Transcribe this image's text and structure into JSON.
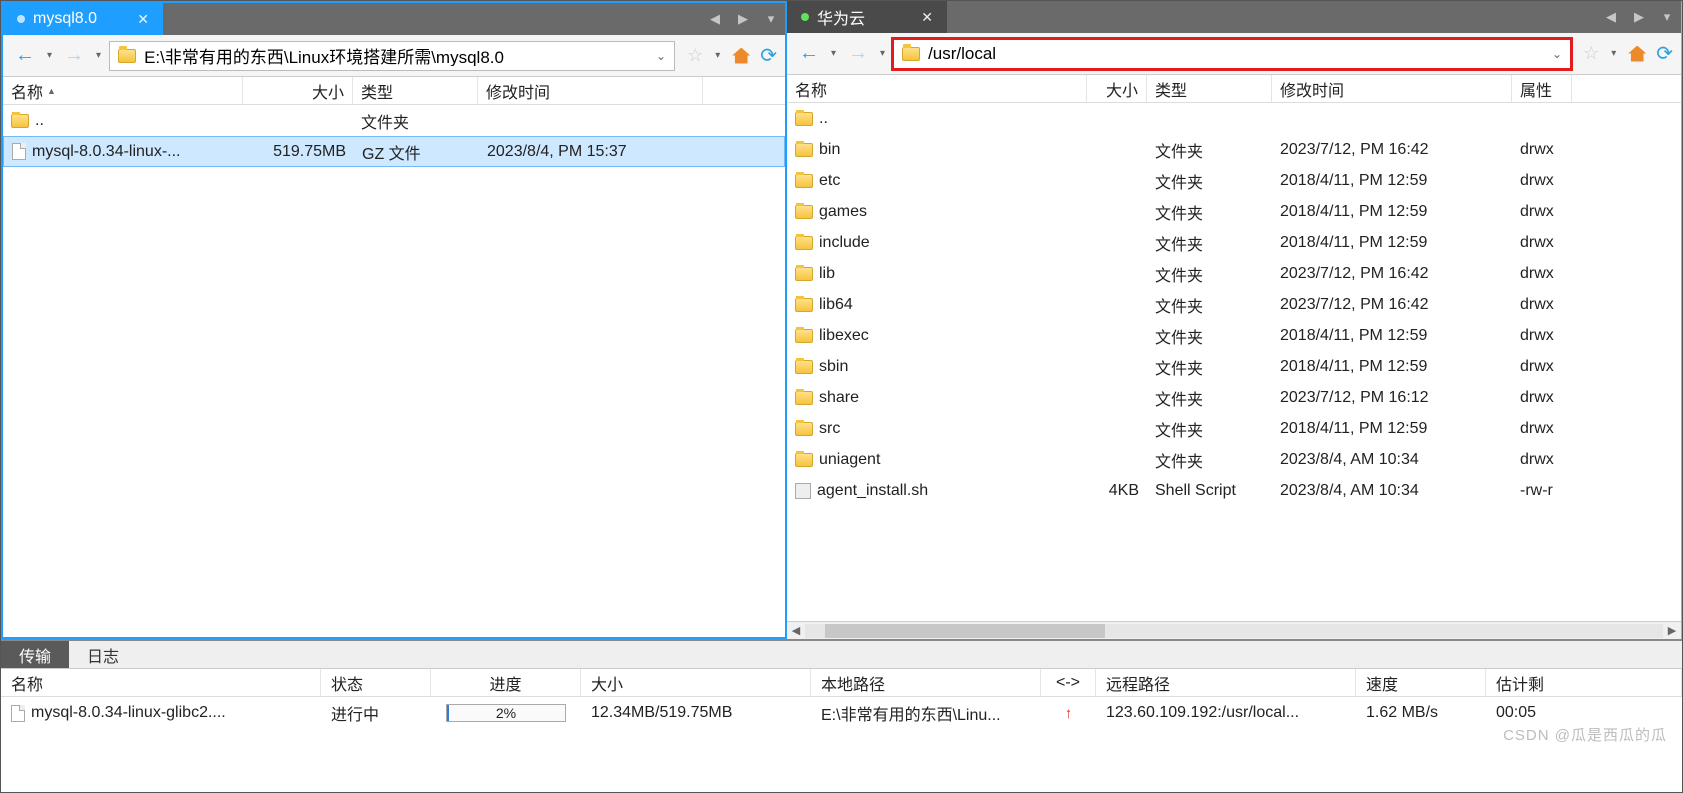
{
  "left": {
    "tab_label": "mysql8.0",
    "path": "E:\\非常有用的东西\\Linux环境搭建所需\\mysql8.0",
    "columns": {
      "name": "名称",
      "size": "大小",
      "type": "类型",
      "mod": "修改时间"
    },
    "rows": [
      {
        "icon": "folder",
        "name": "..",
        "size": "",
        "type": "文件夹",
        "mod": ""
      },
      {
        "icon": "file",
        "name": "mysql-8.0.34-linux-...",
        "size": "519.75MB",
        "type": "GZ 文件",
        "mod": "2023/8/4, PM 15:37",
        "selected": true
      }
    ]
  },
  "right": {
    "tab_label": "华为云",
    "path": "/usr/local",
    "columns": {
      "name": "名称",
      "size": "大小",
      "type": "类型",
      "mod": "修改时间",
      "attr": "属性"
    },
    "rows": [
      {
        "icon": "folder",
        "name": "..",
        "size": "",
        "type": "",
        "mod": "",
        "attr": ""
      },
      {
        "icon": "folder",
        "name": "bin",
        "size": "",
        "type": "文件夹",
        "mod": "2023/7/12, PM 16:42",
        "attr": "drwx"
      },
      {
        "icon": "folder",
        "name": "etc",
        "size": "",
        "type": "文件夹",
        "mod": "2018/4/11, PM 12:59",
        "attr": "drwx"
      },
      {
        "icon": "folder",
        "name": "games",
        "size": "",
        "type": "文件夹",
        "mod": "2018/4/11, PM 12:59",
        "attr": "drwx"
      },
      {
        "icon": "folder",
        "name": "include",
        "size": "",
        "type": "文件夹",
        "mod": "2018/4/11, PM 12:59",
        "attr": "drwx"
      },
      {
        "icon": "folder",
        "name": "lib",
        "size": "",
        "type": "文件夹",
        "mod": "2023/7/12, PM 16:42",
        "attr": "drwx"
      },
      {
        "icon": "folder",
        "name": "lib64",
        "size": "",
        "type": "文件夹",
        "mod": "2023/7/12, PM 16:42",
        "attr": "drwx"
      },
      {
        "icon": "folder",
        "name": "libexec",
        "size": "",
        "type": "文件夹",
        "mod": "2018/4/11, PM 12:59",
        "attr": "drwx"
      },
      {
        "icon": "folder",
        "name": "sbin",
        "size": "",
        "type": "文件夹",
        "mod": "2018/4/11, PM 12:59",
        "attr": "drwx"
      },
      {
        "icon": "folder",
        "name": "share",
        "size": "",
        "type": "文件夹",
        "mod": "2023/7/12, PM 16:12",
        "attr": "drwx"
      },
      {
        "icon": "folder",
        "name": "src",
        "size": "",
        "type": "文件夹",
        "mod": "2018/4/11, PM 12:59",
        "attr": "drwx"
      },
      {
        "icon": "folder",
        "name": "uniagent",
        "size": "",
        "type": "文件夹",
        "mod": "2023/8/4, AM 10:34",
        "attr": "drwx"
      },
      {
        "icon": "sh",
        "name": "agent_install.sh",
        "size": "4KB",
        "type": "Shell Script",
        "mod": "2023/8/4, AM 10:34",
        "attr": "-rw-r"
      }
    ]
  },
  "bottom": {
    "tabs": {
      "transfer": "传输",
      "log": "日志"
    },
    "columns": {
      "name": "名称",
      "status": "状态",
      "prog": "进度",
      "size": "大小",
      "local": "本地路径",
      "dir": "<->",
      "remote": "远程路径",
      "speed": "速度",
      "eta": "估计剩"
    },
    "row": {
      "name": "mysql-8.0.34-linux-glibc2....",
      "status": "进行中",
      "prog_pct": 2,
      "prog_label": "2%",
      "size": "12.34MB/519.75MB",
      "local": "E:\\非常有用的东西\\Linu...",
      "dir_icon": "↑",
      "remote": "123.60.109.192:/usr/local...",
      "speed": "1.62 MB/s",
      "eta": "00:05"
    }
  },
  "watermark": "CSDN @瓜是西瓜的瓜"
}
